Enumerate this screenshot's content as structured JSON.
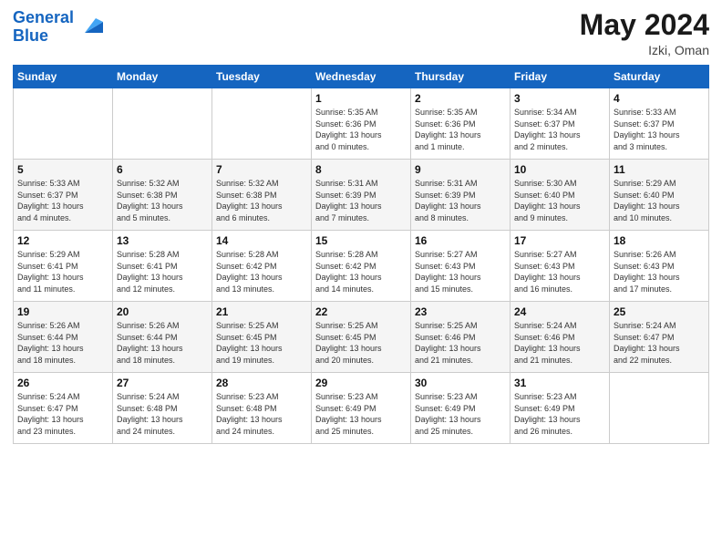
{
  "header": {
    "logo_line1": "General",
    "logo_line2": "Blue",
    "month": "May 2024",
    "location": "Izki, Oman"
  },
  "days_of_week": [
    "Sunday",
    "Monday",
    "Tuesday",
    "Wednesday",
    "Thursday",
    "Friday",
    "Saturday"
  ],
  "weeks": [
    [
      {
        "day": "",
        "info": ""
      },
      {
        "day": "",
        "info": ""
      },
      {
        "day": "",
        "info": ""
      },
      {
        "day": "1",
        "info": "Sunrise: 5:35 AM\nSunset: 6:36 PM\nDaylight: 13 hours\nand 0 minutes."
      },
      {
        "day": "2",
        "info": "Sunrise: 5:35 AM\nSunset: 6:36 PM\nDaylight: 13 hours\nand 1 minute."
      },
      {
        "day": "3",
        "info": "Sunrise: 5:34 AM\nSunset: 6:37 PM\nDaylight: 13 hours\nand 2 minutes."
      },
      {
        "day": "4",
        "info": "Sunrise: 5:33 AM\nSunset: 6:37 PM\nDaylight: 13 hours\nand 3 minutes."
      }
    ],
    [
      {
        "day": "5",
        "info": "Sunrise: 5:33 AM\nSunset: 6:37 PM\nDaylight: 13 hours\nand 4 minutes."
      },
      {
        "day": "6",
        "info": "Sunrise: 5:32 AM\nSunset: 6:38 PM\nDaylight: 13 hours\nand 5 minutes."
      },
      {
        "day": "7",
        "info": "Sunrise: 5:32 AM\nSunset: 6:38 PM\nDaylight: 13 hours\nand 6 minutes."
      },
      {
        "day": "8",
        "info": "Sunrise: 5:31 AM\nSunset: 6:39 PM\nDaylight: 13 hours\nand 7 minutes."
      },
      {
        "day": "9",
        "info": "Sunrise: 5:31 AM\nSunset: 6:39 PM\nDaylight: 13 hours\nand 8 minutes."
      },
      {
        "day": "10",
        "info": "Sunrise: 5:30 AM\nSunset: 6:40 PM\nDaylight: 13 hours\nand 9 minutes."
      },
      {
        "day": "11",
        "info": "Sunrise: 5:29 AM\nSunset: 6:40 PM\nDaylight: 13 hours\nand 10 minutes."
      }
    ],
    [
      {
        "day": "12",
        "info": "Sunrise: 5:29 AM\nSunset: 6:41 PM\nDaylight: 13 hours\nand 11 minutes."
      },
      {
        "day": "13",
        "info": "Sunrise: 5:28 AM\nSunset: 6:41 PM\nDaylight: 13 hours\nand 12 minutes."
      },
      {
        "day": "14",
        "info": "Sunrise: 5:28 AM\nSunset: 6:42 PM\nDaylight: 13 hours\nand 13 minutes."
      },
      {
        "day": "15",
        "info": "Sunrise: 5:28 AM\nSunset: 6:42 PM\nDaylight: 13 hours\nand 14 minutes."
      },
      {
        "day": "16",
        "info": "Sunrise: 5:27 AM\nSunset: 6:43 PM\nDaylight: 13 hours\nand 15 minutes."
      },
      {
        "day": "17",
        "info": "Sunrise: 5:27 AM\nSunset: 6:43 PM\nDaylight: 13 hours\nand 16 minutes."
      },
      {
        "day": "18",
        "info": "Sunrise: 5:26 AM\nSunset: 6:43 PM\nDaylight: 13 hours\nand 17 minutes."
      }
    ],
    [
      {
        "day": "19",
        "info": "Sunrise: 5:26 AM\nSunset: 6:44 PM\nDaylight: 13 hours\nand 18 minutes."
      },
      {
        "day": "20",
        "info": "Sunrise: 5:26 AM\nSunset: 6:44 PM\nDaylight: 13 hours\nand 18 minutes."
      },
      {
        "day": "21",
        "info": "Sunrise: 5:25 AM\nSunset: 6:45 PM\nDaylight: 13 hours\nand 19 minutes."
      },
      {
        "day": "22",
        "info": "Sunrise: 5:25 AM\nSunset: 6:45 PM\nDaylight: 13 hours\nand 20 minutes."
      },
      {
        "day": "23",
        "info": "Sunrise: 5:25 AM\nSunset: 6:46 PM\nDaylight: 13 hours\nand 21 minutes."
      },
      {
        "day": "24",
        "info": "Sunrise: 5:24 AM\nSunset: 6:46 PM\nDaylight: 13 hours\nand 21 minutes."
      },
      {
        "day": "25",
        "info": "Sunrise: 5:24 AM\nSunset: 6:47 PM\nDaylight: 13 hours\nand 22 minutes."
      }
    ],
    [
      {
        "day": "26",
        "info": "Sunrise: 5:24 AM\nSunset: 6:47 PM\nDaylight: 13 hours\nand 23 minutes."
      },
      {
        "day": "27",
        "info": "Sunrise: 5:24 AM\nSunset: 6:48 PM\nDaylight: 13 hours\nand 24 minutes."
      },
      {
        "day": "28",
        "info": "Sunrise: 5:23 AM\nSunset: 6:48 PM\nDaylight: 13 hours\nand 24 minutes."
      },
      {
        "day": "29",
        "info": "Sunrise: 5:23 AM\nSunset: 6:49 PM\nDaylight: 13 hours\nand 25 minutes."
      },
      {
        "day": "30",
        "info": "Sunrise: 5:23 AM\nSunset: 6:49 PM\nDaylight: 13 hours\nand 25 minutes."
      },
      {
        "day": "31",
        "info": "Sunrise: 5:23 AM\nSunset: 6:49 PM\nDaylight: 13 hours\nand 26 minutes."
      },
      {
        "day": "",
        "info": ""
      }
    ]
  ]
}
